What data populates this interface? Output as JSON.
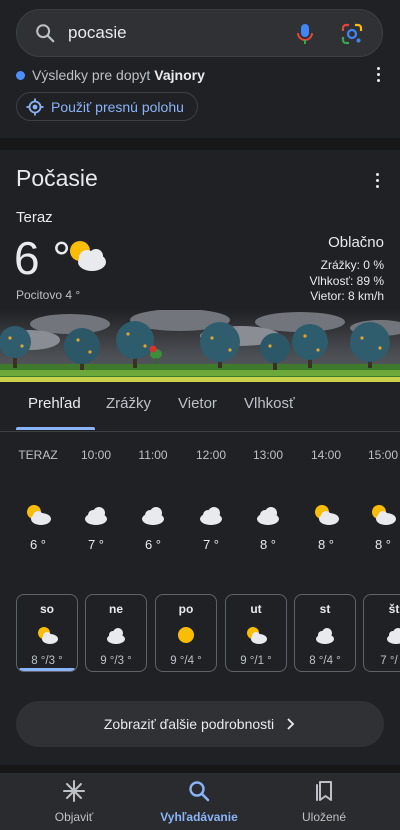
{
  "search": {
    "query": "pocasie"
  },
  "location": {
    "prefix": "Výsledky pre dopyt",
    "place": "Vajnory",
    "precise_button": "Použiť presnú polohu"
  },
  "weather": {
    "title": "Počasie",
    "now_label": "Teraz",
    "temp": "6 °",
    "feels_like": "Pocitovo 4 °",
    "condition": "Oblačno",
    "precip": "Zrážky: 0 %",
    "humidity": "Vlhkosť: 89 %",
    "wind": "Vietor: 8 km/h"
  },
  "tabs": [
    "Prehľad",
    "Zrážky",
    "Vietor",
    "Vlhkosť"
  ],
  "hourly": [
    {
      "label": "TERAZ",
      "temp": "6 °",
      "icon": "partly-cloudy-icon"
    },
    {
      "label": "10:00",
      "temp": "7 °",
      "icon": "cloud-icon"
    },
    {
      "label": "11:00",
      "temp": "6 °",
      "icon": "cloud-icon"
    },
    {
      "label": "12:00",
      "temp": "7 °",
      "icon": "cloud-icon"
    },
    {
      "label": "13:00",
      "temp": "8 °",
      "icon": "cloud-icon"
    },
    {
      "label": "14:00",
      "temp": "8 °",
      "icon": "partly-cloudy-icon"
    },
    {
      "label": "15:00",
      "temp": "8 °",
      "icon": "partly-cloudy-icon"
    }
  ],
  "daily": [
    {
      "day": "so",
      "temp": "8 °/3 °",
      "icon": "partly-cloudy-icon"
    },
    {
      "day": "ne",
      "temp": "9 °/3 °",
      "icon": "cloud-icon"
    },
    {
      "day": "po",
      "temp": "9 °/4 °",
      "icon": "sun-icon"
    },
    {
      "day": "ut",
      "temp": "9 °/1 °",
      "icon": "partly-cloudy-icon"
    },
    {
      "day": "st",
      "temp": "8 °/4 °",
      "icon": "cloud-icon"
    },
    {
      "day": "št",
      "temp": "7 °/",
      "icon": "cloud-icon"
    }
  ],
  "more_button": "Zobraziť ďalšie podrobnosti",
  "nav": {
    "discover": "Objaviť",
    "search": "Vyhľadávanie",
    "saved": "Uložené"
  },
  "colors": {
    "accent": "#8ab4f8",
    "background": "#202124",
    "sun": "#fbbc04"
  }
}
